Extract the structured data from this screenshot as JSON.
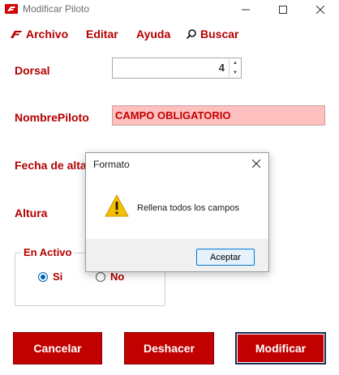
{
  "window": {
    "title": "Modificar Piloto",
    "controls": [
      "minimize-icon",
      "maximize-icon",
      "close-icon"
    ]
  },
  "menu": {
    "items": [
      "Archivo",
      "Editar",
      "Ayuda",
      "Buscar"
    ]
  },
  "form": {
    "dorsal_label": "Dorsal",
    "dorsal_value": "4",
    "nombre_label": "NombrePiloto",
    "nombre_value": "CAMPO OBLIGATORIO",
    "fecha_label": "Fecha de alta",
    "altura_label": "Altura",
    "activo": {
      "title": "En Activo",
      "options": [
        "Si",
        "No"
      ],
      "selected": "Si"
    }
  },
  "buttons": {
    "cancel": "Cancelar",
    "undo": "Deshacer",
    "modify": "Modificar"
  },
  "dialog": {
    "title": "Formato",
    "message": "Rellena todos los campos",
    "ok": "Aceptar",
    "icon": "warning-icon"
  },
  "colors": {
    "accent": "#b50000",
    "button_bg": "#c10000",
    "error_bg": "#ffc0c0"
  }
}
